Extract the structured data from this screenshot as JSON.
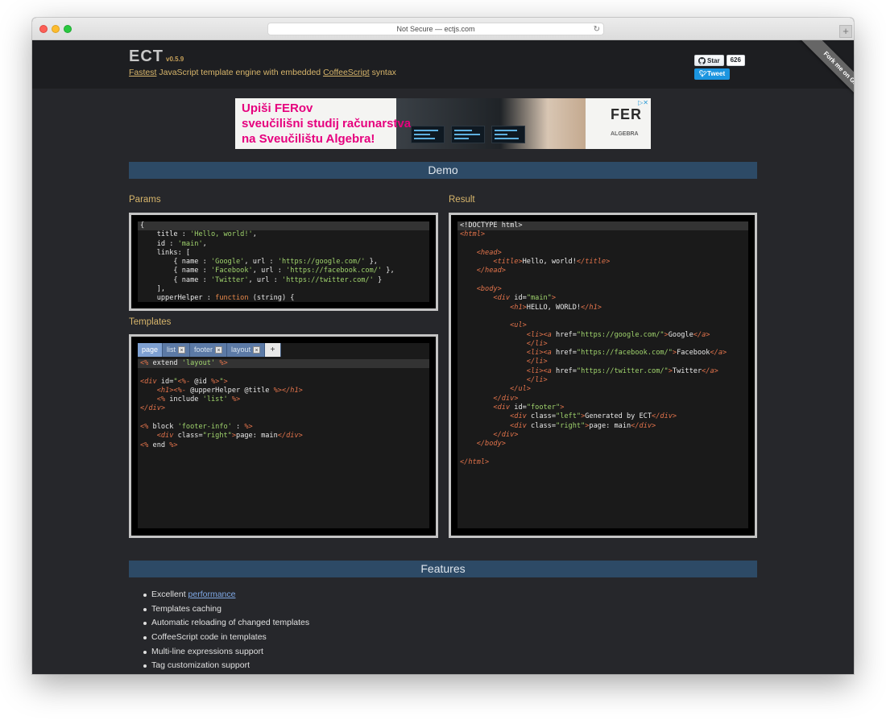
{
  "browser": {
    "url_text": "Not Secure — ectjs.com",
    "reload_glyph": "↻",
    "new_tab_glyph": "+"
  },
  "header": {
    "logo": "ECT",
    "version": "v0.5.9",
    "tagline_link1": "Fastest",
    "tagline_mid": " JavaScript template engine with embedded ",
    "tagline_link2": "CoffeeScript",
    "tagline_end": " syntax",
    "star_label": "Star",
    "star_count": "626",
    "tweet_label": "Tweet",
    "fork_ribbon": "Fork me on GitHub"
  },
  "banner": {
    "line1": "Upiši FERov",
    "line2": "sveučilišni studij računarstva",
    "line3": "na Sveučilištu Algebra!",
    "brand1": "FER",
    "brand2": "ALGEBRA",
    "ad_icon": "▷✕"
  },
  "demo": {
    "section_title": "Demo",
    "params_label": "Params",
    "templates_label": "Templates",
    "result_label": "Result",
    "tabs": [
      {
        "label": "page",
        "closable": false
      },
      {
        "label": "list",
        "closable": true
      },
      {
        "label": "footer",
        "closable": true
      },
      {
        "label": "layout",
        "closable": true
      }
    ],
    "tab_add_label": "+",
    "tab_close_glyph": "×"
  },
  "features": {
    "section_title": "Features",
    "items": [
      "Templates caching",
      "Automatic reloading of changed templates",
      "CoffeeScript code in templates",
      "Multi-line expressions support",
      "Tag customization support"
    ],
    "first_prefix": "Excellent ",
    "first_link": "performance"
  },
  "colors": {
    "background": "#26272b",
    "header": "#1d1e21",
    "accent_gold": "#d7b56b",
    "section_bar": "#2d4a66",
    "tab_active": "#7ea0d2"
  }
}
